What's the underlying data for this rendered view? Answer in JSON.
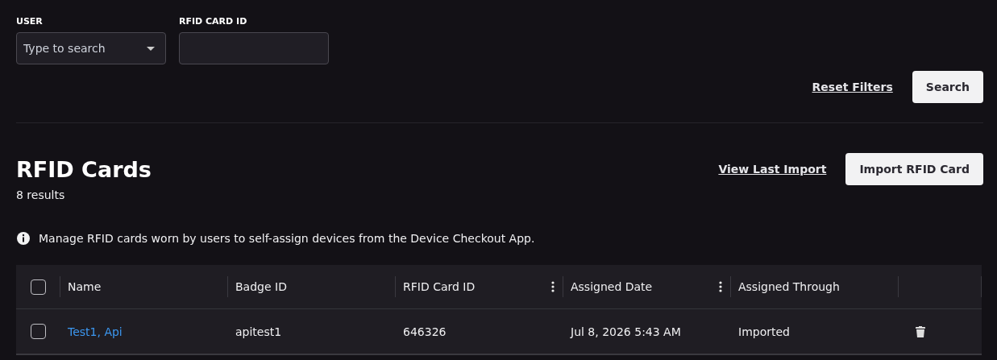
{
  "filters": [
    {
      "label": "USER",
      "kind": "dropdown",
      "placeholder": "Type to search"
    },
    {
      "label": "RFID CARD ID",
      "kind": "text"
    }
  ],
  "filter_actions": {
    "reset": "Reset Filters",
    "search": "Search"
  },
  "header": {
    "title": "RFID Cards",
    "count": "8 results",
    "link": "View Last Import",
    "button": "Import RFID Card"
  },
  "info": "Manage RFID cards worn by users to self-assign devices from the Device Checkout App.",
  "table": {
    "select_all": {
      "checked": false
    },
    "columns": [
      {
        "label": "Name",
        "menu": false
      },
      {
        "label": "Badge ID",
        "menu": false
      },
      {
        "label": "RFID Card ID",
        "menu": true
      },
      {
        "label": "Assigned Date",
        "menu": true
      },
      {
        "label": "Assigned Through",
        "menu": false
      }
    ],
    "rows": [
      {
        "checked": false,
        "cells": [
          "Test1, Api",
          "apitest1",
          "646326",
          "Jul 8, 2026 5:43 AM",
          "Imported"
        ]
      }
    ]
  }
}
